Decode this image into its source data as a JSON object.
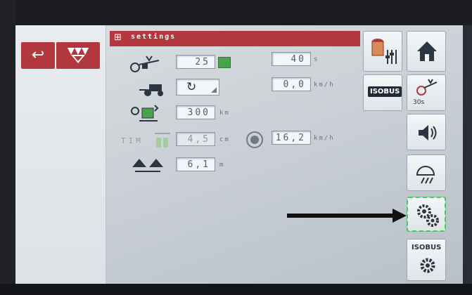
{
  "header": {
    "title": "settings",
    "icon": "settings-grid-icon"
  },
  "left_panel": {
    "back_icon": "↩",
    "logo": "massey-ferguson-logo"
  },
  "rows": {
    "r1": {
      "value": "25",
      "right_value": "40",
      "right_unit": "s"
    },
    "r2": {
      "right_value": "0,0",
      "right_unit": "km/h"
    },
    "r3": {
      "value": "300",
      "unit": "km"
    },
    "r4": {
      "label": "TIM",
      "value": "4,5",
      "unit": "cm",
      "right_value": "16,2",
      "right_unit": "km/h"
    },
    "r5": {
      "value": "6,1",
      "unit": "m"
    }
  },
  "toolbar": {
    "isobus_label": "ISOBUS",
    "isobus_top_label": "ISOBUS",
    "timer_label": "30s",
    "selected": "settings-gears-button"
  },
  "colors": {
    "header_red": "#b3383d",
    "selection_green": "#39d64b"
  }
}
